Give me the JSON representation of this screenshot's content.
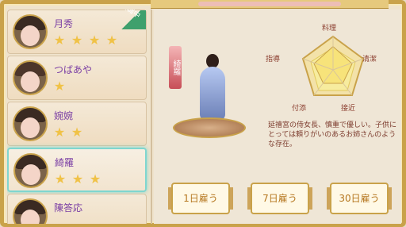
{
  "status_badge": "任職中",
  "characters": [
    {
      "name": "月秀",
      "stars": 4
    },
    {
      "name": "つばあや",
      "stars": 1
    },
    {
      "name": "婉婉",
      "stars": 2
    },
    {
      "name": "綺羅",
      "stars": 3
    },
    {
      "name": "陳答応",
      "stars": 0
    }
  ],
  "selected_index": 3,
  "detail": {
    "vertical_name": "綺羅",
    "radar_labels": [
      "料理",
      "清潔",
      "接近",
      "付添",
      "指導"
    ],
    "radar_values": [
      0.7,
      0.6,
      0.5,
      0.5,
      0.6
    ],
    "description": "延禧宮の侍女長、慎重で優しい。子供にとっては頼りがいのあるお姉さんのような存在。"
  },
  "buttons": [
    "1日雇う",
    "7日雇う",
    "30日雇う"
  ],
  "colors": {
    "accent": "#c9a24a",
    "name": "#7a3ea4",
    "star": "#f0c247",
    "radar_fill": "#f7e37a"
  }
}
